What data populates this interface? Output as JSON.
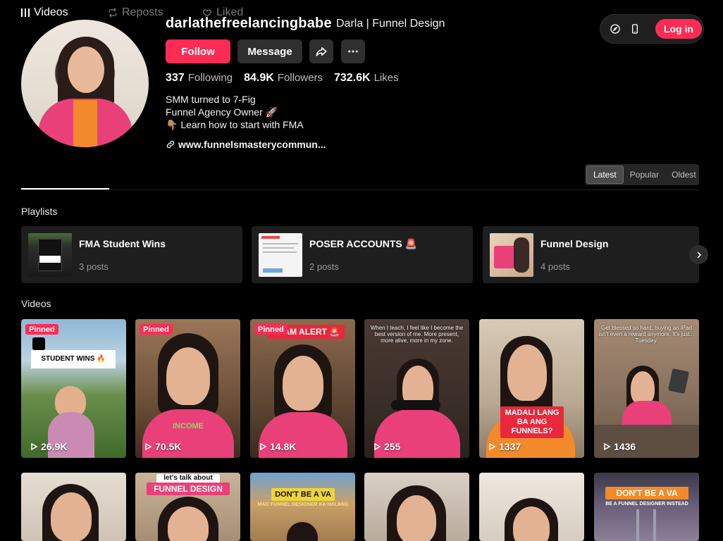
{
  "profile": {
    "username": "darlathefreelancingbabe",
    "nickname": "Darla | Funnel Design",
    "follow_label": "Follow",
    "message_label": "Message",
    "stats": [
      {
        "value": "337",
        "label": "Following"
      },
      {
        "value": "84.9K",
        "label": "Followers"
      },
      {
        "value": "732.6K",
        "label": "Likes"
      }
    ],
    "bio": [
      "SMM turned to 7-Fig",
      "Funnel Agency Owner 🚀",
      "👇🏽 Learn how to start with FMA"
    ],
    "link": "www.funnelsmasterycommun..."
  },
  "top_bar": {
    "login_label": "Log in",
    "icons": [
      "compass-icon",
      "mobile-icon"
    ]
  },
  "tabs": [
    {
      "label": "Videos",
      "icon": "grid-icon",
      "active": true
    },
    {
      "label": "Reposts",
      "icon": "repost-icon",
      "active": false
    },
    {
      "label": "Liked",
      "icon": "heart-icon",
      "active": false
    }
  ],
  "sort": [
    {
      "label": "Latest",
      "active": true
    },
    {
      "label": "Popular",
      "active": false
    },
    {
      "label": "Oldest",
      "active": false
    }
  ],
  "playlists_title": "Playlists",
  "playlists": [
    {
      "title": "FMA Student Wins",
      "count": "3 posts"
    },
    {
      "title": "POSER ACCOUNTS 🚨",
      "count": "2 posts"
    },
    {
      "title": "Funnel Design",
      "count": "4 posts"
    }
  ],
  "videos_title": "Videos",
  "videos": [
    {
      "views": "26.9K",
      "pinned": "Pinned",
      "overlay": "STUDENT WINS 🔥"
    },
    {
      "views": "70.5K",
      "pinned": "Pinned",
      "overlay": "INCOME"
    },
    {
      "views": "14.8K",
      "pinned": "Pinned",
      "overlay": "SCAM ALERT 🚨"
    },
    {
      "views": "255",
      "caption": "When I teach, I feel like I become the best version of me. More present, more alive, more in my zone."
    },
    {
      "views": "1337",
      "overlay": "MADALI LANG BA ANG FUNNELS?"
    },
    {
      "views": "1436",
      "caption": "Get blessed so hard, buying an iPad isn't even a reward anymore. It's just... Tuesday."
    }
  ],
  "videos_row2": [
    {
      "overlay": ""
    },
    {
      "overlay_top": "let's talk about",
      "overlay": "FUNNEL DESIGN"
    },
    {
      "overlay": "DON'T BE A VA",
      "sub": "MAG FUNNEL DESIGNER KA NALANG"
    },
    {
      "overlay": ""
    },
    {
      "overlay": ""
    },
    {
      "overlay": "DON'T BE A VA",
      "sub": "BE A FUNNEL DESIGNER INSTEAD"
    }
  ]
}
